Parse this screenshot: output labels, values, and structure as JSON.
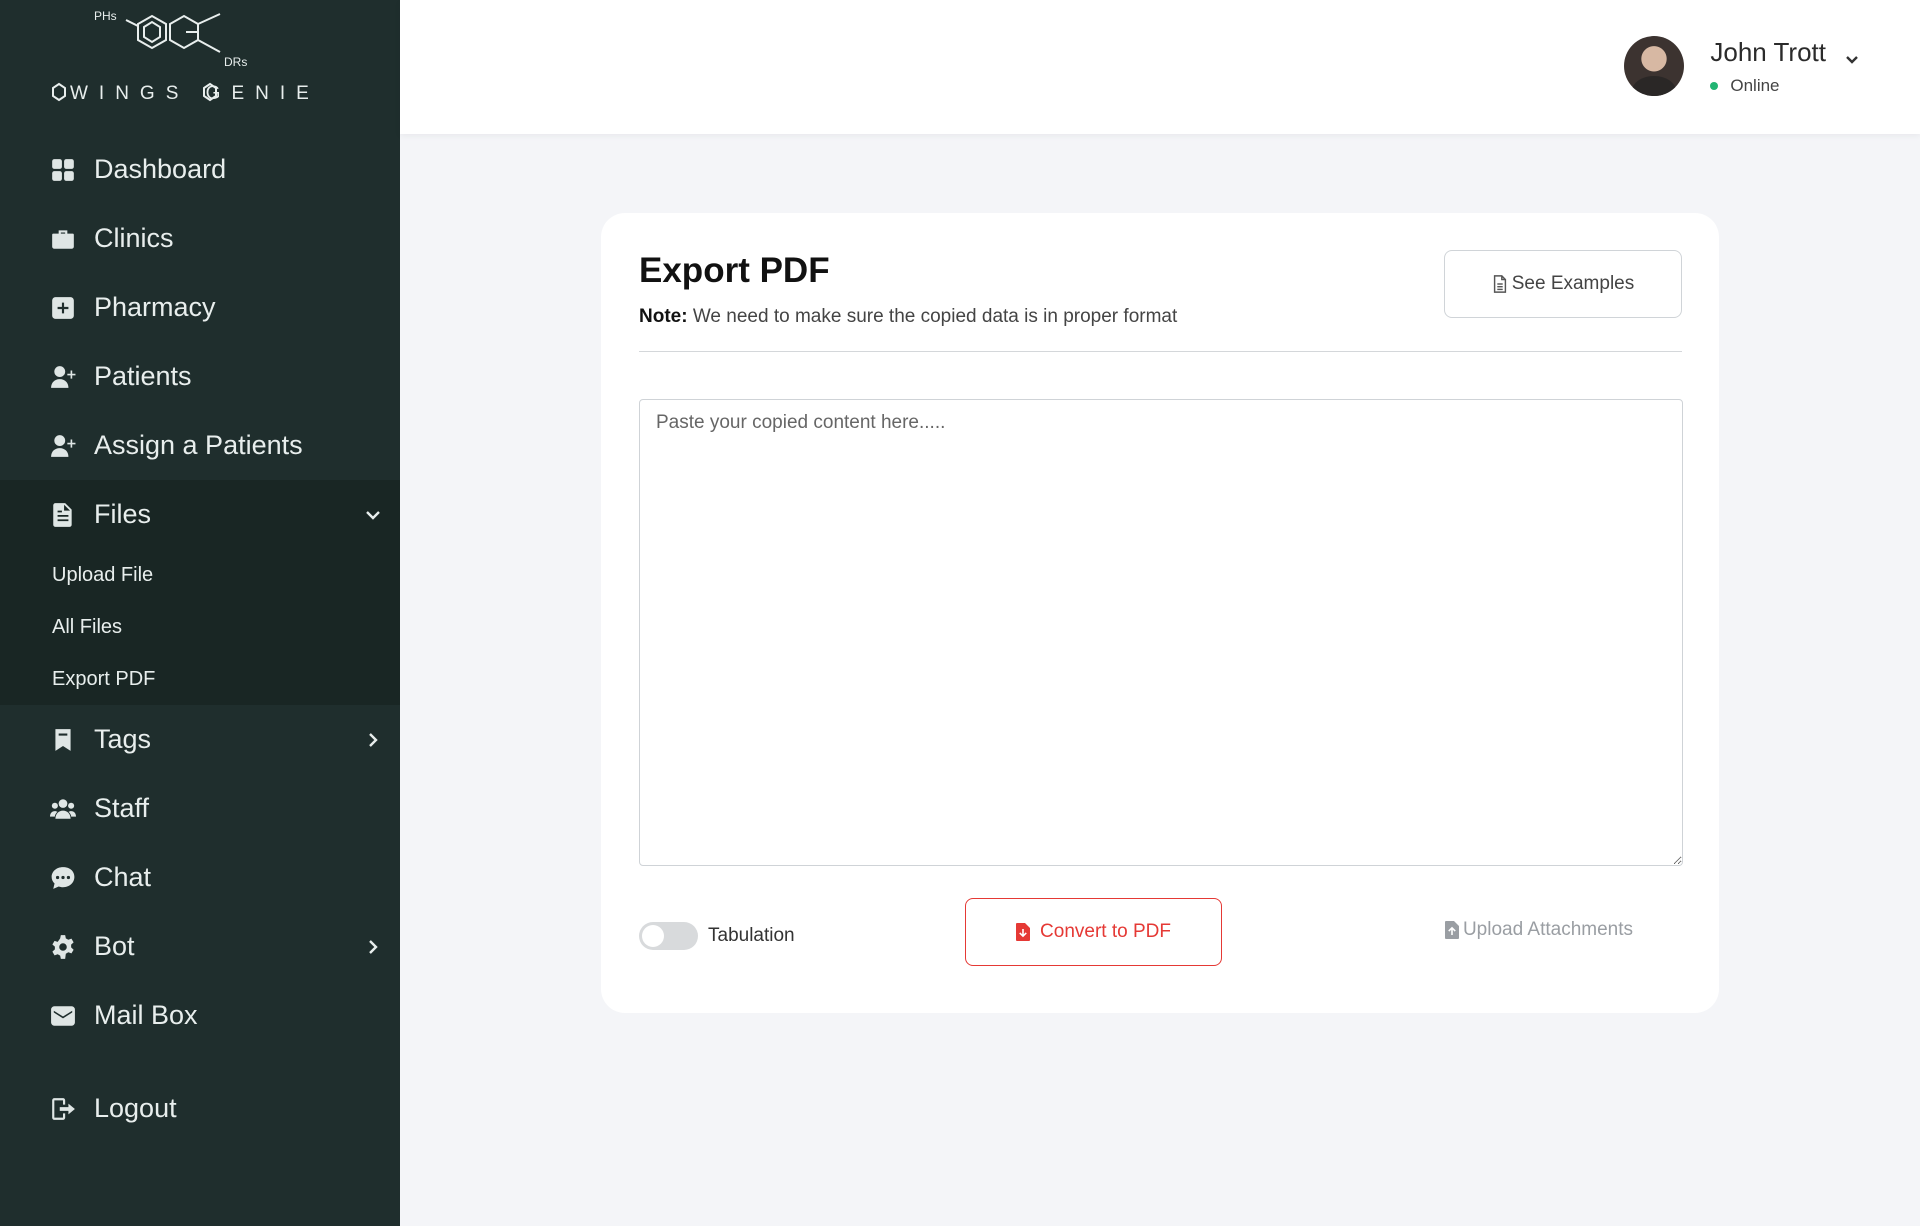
{
  "brand": {
    "logo_text": "WINGS GENIE",
    "logo_tag_left": "PHs",
    "logo_tag_right": "DRs"
  },
  "sidebar": {
    "items": [
      {
        "label": "Dashboard",
        "icon": "grid-icon"
      },
      {
        "label": "Clinics",
        "icon": "briefcase-medical-icon"
      },
      {
        "label": "Pharmacy",
        "icon": "plus-square-icon"
      },
      {
        "label": "Patients",
        "icon": "user-plus-icon"
      },
      {
        "label": "Assign a Patients",
        "icon": "user-plus-icon"
      }
    ],
    "files": {
      "label": "Files",
      "icon": "file-icon",
      "expanded": true,
      "children": [
        "Upload File",
        "All Files",
        "Export PDF"
      ]
    },
    "items_after": [
      {
        "label": "Tags",
        "icon": "bookmark-icon",
        "has_submenu": true
      },
      {
        "label": "Staff",
        "icon": "users-icon"
      },
      {
        "label": "Chat",
        "icon": "chat-icon"
      },
      {
        "label": "Bot",
        "icon": "gear-icon",
        "has_submenu": true
      },
      {
        "label": "Mail Box",
        "icon": "envelope-icon"
      }
    ],
    "logout": {
      "label": "Logout",
      "icon": "sign-out-icon"
    }
  },
  "header": {
    "user_name": "John Trott",
    "status": "Online",
    "status_color": "#22b573"
  },
  "card": {
    "title": "Export PDF",
    "note_label": "Note:",
    "note_text": " We need to make sure the copied data is in proper format",
    "see_examples_label": "See Examples",
    "textarea_placeholder": "Paste your copied content here.....",
    "textarea_value": "",
    "tabulation_label": "Tabulation",
    "tabulation_on": false,
    "convert_label": "Convert to PDF",
    "upload_label": "Upload Attachments"
  },
  "colors": {
    "sidebar_bg": "#1f2e2d",
    "accent_red": "#e53935",
    "page_bg": "#f4f5f8"
  }
}
